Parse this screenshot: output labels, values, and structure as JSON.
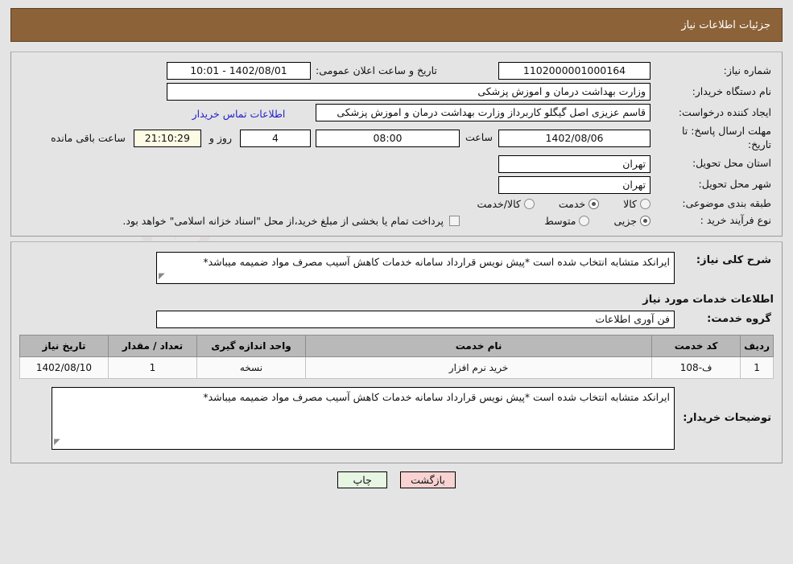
{
  "header": {
    "title": "جزئیات اطلاعات نیاز"
  },
  "info": {
    "need_number_label": "شماره نیاز:",
    "need_number_value": "1102000001000164",
    "announce_datetime_label": "تاریخ و ساعت اعلان عمومی:",
    "announce_datetime_value": "1402/08/01 - 10:01",
    "buyer_org_label": "نام دستگاه خریدار:",
    "buyer_org_value": "وزارت بهداشت  درمان و اموزش پزشکی",
    "creator_label": "ایجاد کننده درخواست:",
    "creator_value": "قاسم عزیزی اصل گیگلو کاربرداز وزارت بهداشت  درمان و اموزش پزشکی",
    "contact_link": "اطلاعات تماس خریدار",
    "deadline_label": "مهلت ارسال پاسخ: تا تاریخ:",
    "deadline_date": "1402/08/06",
    "deadline_hour_label": "ساعت",
    "deadline_hour": "08:00",
    "remaining_days": "4",
    "remaining_days_label": "روز و",
    "remaining_time": "21:10:29",
    "remaining_time_label": "ساعت باقی مانده",
    "province_label": "استان محل تحویل:",
    "province_value": "تهران",
    "city_label": "شهر محل تحویل:",
    "city_value": "تهران",
    "classification_label": "طبقه بندی موضوعی:",
    "classification_options": [
      {
        "label": "کالا",
        "selected": false
      },
      {
        "label": "خدمت",
        "selected": true
      },
      {
        "label": "کالا/خدمت",
        "selected": false
      }
    ],
    "process_label": "نوع فرآیند خرید :",
    "process_options": [
      {
        "label": "جزیی",
        "selected": true
      },
      {
        "label": "متوسط",
        "selected": false
      }
    ],
    "treasury_checkbox_checked": false,
    "treasury_note": "پرداخت تمام یا بخشی از مبلغ خرید،از محل \"اسناد خزانه اسلامی\" خواهد بود."
  },
  "details": {
    "general_desc_label": "شرح کلی نیاز:",
    "general_desc_value": "ایرانکد متشابه انتخاب شده است *پیش نویس قرارداد سامانه خدمات کاهش آسیب مصرف مواد ضمیمه میباشد*",
    "services_section_title": "اطلاعات خدمات مورد نیاز",
    "service_group_label": "گروه خدمت:",
    "service_group_value": "فن آوری اطلاعات",
    "buyer_remarks_label": "توضیحات خریدار:",
    "buyer_remarks_value": "ایرانکد متشابه انتخاب شده است *پیش نویس قرارداد سامانه خدمات کاهش آسیب مصرف مواد ضمیمه میباشد*"
  },
  "items_table": {
    "columns": [
      "ردیف",
      "کد خدمت",
      "نام خدمت",
      "واحد اندازه گیری",
      "تعداد / مقدار",
      "تاریخ نیاز"
    ],
    "rows": [
      {
        "row_no": "1",
        "service_code": "ف-108",
        "service_name": "خرید نرم افزار",
        "unit": "نسخه",
        "quantity": "1",
        "need_date": "1402/08/10"
      }
    ]
  },
  "footer": {
    "print_label": "چاپ",
    "back_label": "بازگشت"
  },
  "watermark": {
    "text": "AriaTender.net"
  },
  "colors": {
    "header_bar": "#8c6239",
    "page_bg": "#e4e4e4",
    "link": "#2222cc",
    "table_header": "#b9b9b9",
    "print_button": "#e7f5e3",
    "back_button": "#f9d2d2",
    "countdown_bg": "#fdfbe4"
  }
}
